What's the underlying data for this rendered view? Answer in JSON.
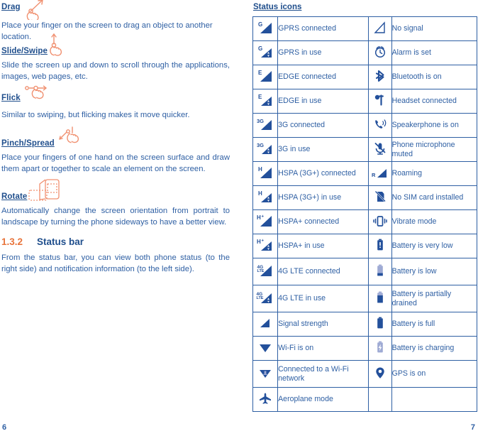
{
  "left_page": {
    "page_number": "6",
    "gestures": [
      {
        "id": "drag",
        "title": "Drag",
        "icon": "hand-drag-icon",
        "body": "Place your finger on the screen to drag an object to another location."
      },
      {
        "id": "slide-swipe",
        "title": "Slide/Swipe",
        "icon": "hand-slide-icon",
        "body": "Slide the screen up and down to scroll through the applications, images, web pages, etc."
      },
      {
        "id": "flick",
        "title": "Flick",
        "icon": "hand-flick-icon",
        "body": "Similar to swiping, but flicking makes it move quicker."
      },
      {
        "id": "pinch-spread",
        "title": "Pinch/Spread",
        "icon": "hand-pinch-icon",
        "body": "Place your fingers of one hand on the screen surface and draw them apart or together to scale an element on the screen."
      },
      {
        "id": "rotate",
        "title": "Rotate",
        "icon": "phone-rotate-icon",
        "body": "Automatically change the screen orientation from portrait to landscape by turning the phone sideways to have a better view."
      }
    ],
    "section": {
      "number": "1.3.2",
      "title": "Status bar",
      "body": "From the status bar, you can view both phone status (to the right side) and notification information (to the left side)."
    }
  },
  "right_page": {
    "page_number": "7",
    "heading": "Status icons",
    "table": {
      "rows": [
        {
          "left": {
            "icon": "signal-gprs-connected-icon",
            "label": "GPRS connected"
          },
          "right": {
            "icon": "no-signal-icon",
            "label": "No signal"
          }
        },
        {
          "left": {
            "icon": "signal-gprs-in-use-icon",
            "label": "GPRS in use"
          },
          "right": {
            "icon": "alarm-clock-icon",
            "label": "Alarm is set"
          }
        },
        {
          "left": {
            "icon": "signal-edge-connected-icon",
            "label": "EDGE connected"
          },
          "right": {
            "icon": "bluetooth-icon",
            "label": "Bluetooth is on"
          }
        },
        {
          "left": {
            "icon": "signal-edge-in-use-icon",
            "label": "EDGE in use"
          },
          "right": {
            "icon": "headset-icon",
            "label": "Headset connected"
          }
        },
        {
          "left": {
            "icon": "signal-3g-connected-icon",
            "label": "3G connected"
          },
          "right": {
            "icon": "speakerphone-icon",
            "label": "Speakerphone is on"
          }
        },
        {
          "left": {
            "icon": "signal-3g-in-use-icon",
            "label": "3G in use"
          },
          "right": {
            "icon": "microphone-muted-icon",
            "label": "Phone microphone muted"
          }
        },
        {
          "left": {
            "icon": "signal-hspa-connected-icon",
            "label": "HSPA (3G+) connected"
          },
          "right": {
            "icon": "roaming-icon",
            "label": "Roaming"
          }
        },
        {
          "left": {
            "icon": "signal-hspa-in-use-icon",
            "label": "HSPA (3G+) in use"
          },
          "right": {
            "icon": "no-sim-card-icon",
            "label": "No SIM card installed"
          }
        },
        {
          "left": {
            "icon": "signal-hspaplus-connected-icon",
            "label": "HSPA+ connected"
          },
          "right": {
            "icon": "vibrate-icon",
            "label": "Vibrate mode"
          }
        },
        {
          "left": {
            "icon": "signal-hspaplus-in-use-icon",
            "label": "HSPA+ in use"
          },
          "right": {
            "icon": "battery-very-low-icon",
            "label": "Battery is very low"
          }
        },
        {
          "left": {
            "icon": "signal-4glte-connected-icon",
            "label": "4G LTE connected"
          },
          "right": {
            "icon": "battery-low-icon",
            "label": "Battery is low"
          }
        },
        {
          "left": {
            "icon": "signal-4glte-in-use-icon",
            "label": "4G LTE in use"
          },
          "right": {
            "icon": "battery-partial-icon",
            "label": "Battery is partially drained"
          }
        },
        {
          "left": {
            "icon": "signal-strength-icon",
            "label": "Signal strength"
          },
          "right": {
            "icon": "battery-full-icon",
            "label": "Battery is full"
          }
        },
        {
          "left": {
            "icon": "wifi-on-icon",
            "label": "Wi-Fi is on"
          },
          "right": {
            "icon": "battery-charging-icon",
            "label": "Battery is charging"
          }
        },
        {
          "left": {
            "icon": "wifi-connected-icon",
            "label": "Connected to a Wi-Fi network"
          },
          "right": {
            "icon": "gps-pin-icon",
            "label": "GPS is on"
          }
        },
        {
          "left": {
            "icon": "aeroplane-mode-icon",
            "label": "Aeroplane mode"
          },
          "right": {
            "icon": "",
            "label": ""
          }
        }
      ]
    }
  },
  "colors": {
    "text_blue": "#2E5FA3",
    "heading_blue": "#1F4E8C",
    "accent_orange": "#E8743B",
    "gesture_icon_orange": "#F09070",
    "icon_fill": "#23509B",
    "icon_light": "#9EAAD4"
  }
}
